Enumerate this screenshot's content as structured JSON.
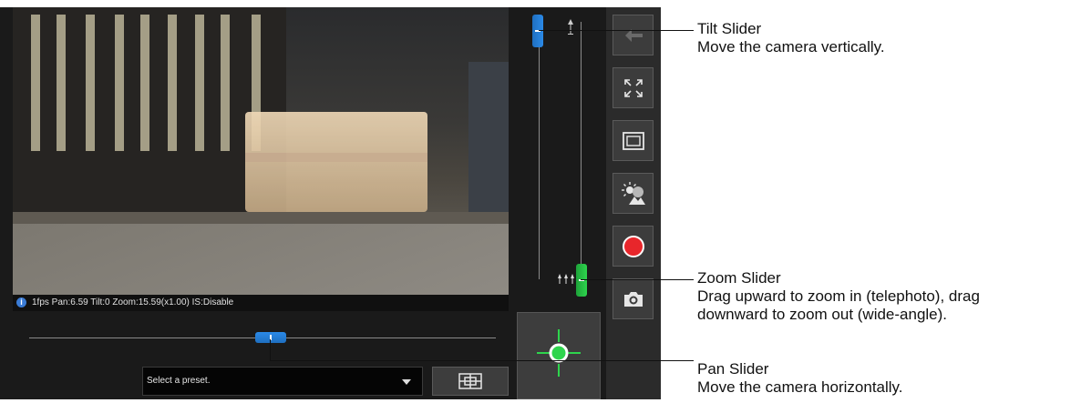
{
  "status_bar": {
    "info_icon": "info-icon",
    "text": "1fps Pan:6.59 Tilt:0 Zoom:15.59(x1.00) IS:Disable"
  },
  "preset": {
    "placeholder": "Select a preset.",
    "dropdown_icon": "chevron-down-icon",
    "preset_button_icon": "preset-grid-icon"
  },
  "toolbar_icons": [
    "back-arrow-icon",
    "fullscreen-icon",
    "screen-size-icon",
    "image-adjust-icon",
    "record-icon",
    "snapshot-camera-icon"
  ],
  "colors": {
    "tilt_slider": "#2b8ae8",
    "pan_slider": "#2b8ae8",
    "zoom_slider": "#2ed54d",
    "record": "#e8262b",
    "joystick": "#2ed54d"
  },
  "annotations": {
    "tilt": {
      "title": "Tilt Slider",
      "desc": "Move the camera vertically."
    },
    "zoom": {
      "title": "Zoom Slider",
      "desc1": "Drag upward to zoom in (telephoto), drag",
      "desc2": "downward to zoom out (wide-angle)."
    },
    "pan": {
      "title": "Pan Slider",
      "desc": "Move the camera horizontally."
    }
  }
}
